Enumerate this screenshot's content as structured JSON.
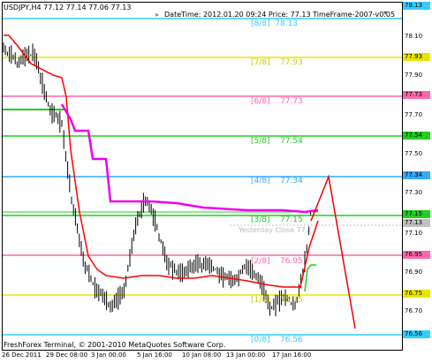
{
  "window": {
    "symbol_line": "USDJPY,H4  77.12 77.14 77.06 77.13",
    "indicator_line": "DateTime: 2012.01.20 09:24   Price: 77.13   TimeFrame-2007-v0.05"
  },
  "murrey_levels": [
    {
      "name": "[8/8]",
      "value": "78.13",
      "color": "#33ccff"
    },
    {
      "name": "[7/8]",
      "value": "77.93",
      "color": "#e6e600"
    },
    {
      "name": "[6/8]",
      "value": "77.73",
      "color": "#ff66aa"
    },
    {
      "name": "[5/8]",
      "value": "77.54",
      "color": "#22cc22"
    },
    {
      "name": "[4/8]",
      "value": "77.34",
      "color": "#33aaff"
    },
    {
      "name": "[3/8]",
      "value": "77.15",
      "color": "#22cc22"
    },
    {
      "name": "[2/8]",
      "value": "76.95",
      "color": "#ff66aa"
    },
    {
      "name": "[1/8]",
      "value": "76.75",
      "color": "#e6e600"
    },
    {
      "name": "[0/8]",
      "value": "76.56",
      "color": "#33ccff"
    }
  ],
  "yesterday_close_label": "Yesterday Close 77.?",
  "price_axis": {
    "ticks": [
      "78.10",
      "77.90",
      "77.70",
      "77.50",
      "77.30",
      "77.10",
      "76.90",
      "76.70"
    ],
    "tags": [
      {
        "text": "78.13",
        "bg": "#33ccff"
      },
      {
        "text": "77.93",
        "bg": "#e6e600"
      },
      {
        "text": "77.73",
        "bg": "#ff66aa"
      },
      {
        "text": "77.54",
        "bg": "#22cc22"
      },
      {
        "text": "77.34",
        "bg": "#33aaff"
      },
      {
        "text": "77.15",
        "bg": "#22cc22"
      },
      {
        "text": "77.13",
        "bg": "#c0c0c0"
      },
      {
        "text": "76.95",
        "bg": "#ff66aa"
      },
      {
        "text": "76.75",
        "bg": "#e6e600"
      },
      {
        "text": "76.56",
        "bg": "#33ccff"
      }
    ]
  },
  "time_axis": [
    "26 Dec 2011",
    "29 Dec 08:00",
    "3 Jan 00:00",
    "5 Jan 16:00",
    "10 Jan 08:00",
    "13 Jan 00:00",
    "17 Jan 16:00"
  ],
  "footer": {
    "copyright": "FreshForex Terminal, © 2001-2010 MetaQuotes Software Corp."
  },
  "colors": {
    "bars": "#000000",
    "moving_average": "#ff0000",
    "trend_line": "#ee00ee",
    "forecast": "#ee0000",
    "highlight_green": "#22cc22"
  },
  "icons": {
    "shift_marker": "triangle-icon",
    "scroll_marker": "down-triangle-icon"
  }
}
